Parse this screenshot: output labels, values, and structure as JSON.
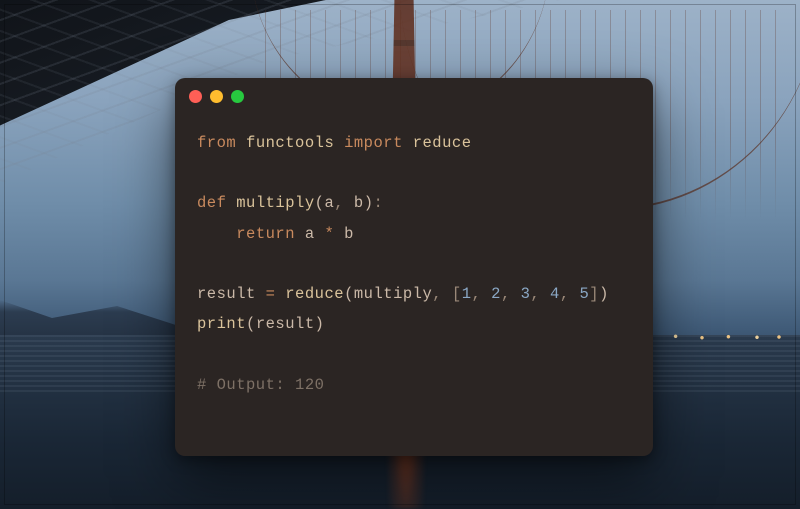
{
  "traffic_lights": {
    "close": "close-button",
    "minimize": "minimize-button",
    "zoom": "zoom-button"
  },
  "code": {
    "line1": {
      "kw_from": "from",
      "module": "functools",
      "kw_import": "import",
      "name": "reduce"
    },
    "line3": {
      "kw_def": "def",
      "fname": "multiply",
      "lpar": "(",
      "a": "a",
      "comma": ",",
      "sp": " ",
      "b": "b",
      "rpar": ")",
      "colon": ":"
    },
    "line4": {
      "indent": "    ",
      "kw_return": "return",
      "a": "a",
      "op": "*",
      "b": "b"
    },
    "line6": {
      "var": "result",
      "eq": "=",
      "fn": "reduce",
      "lpar": "(",
      "arg1": "multiply",
      "comma1": ",",
      "lbr": "[",
      "n1": "1",
      "c1": ",",
      "n2": "2",
      "c2": ",",
      "n3": "3",
      "c3": ",",
      "n4": "4",
      "c4": ",",
      "n5": "5",
      "rbr": "]",
      "rpar": ")"
    },
    "line7": {
      "fn": "print",
      "lpar": "(",
      "arg": "result",
      "rpar": ")"
    },
    "line9": {
      "comment": "# Output: 120"
    }
  },
  "output_value": 120
}
